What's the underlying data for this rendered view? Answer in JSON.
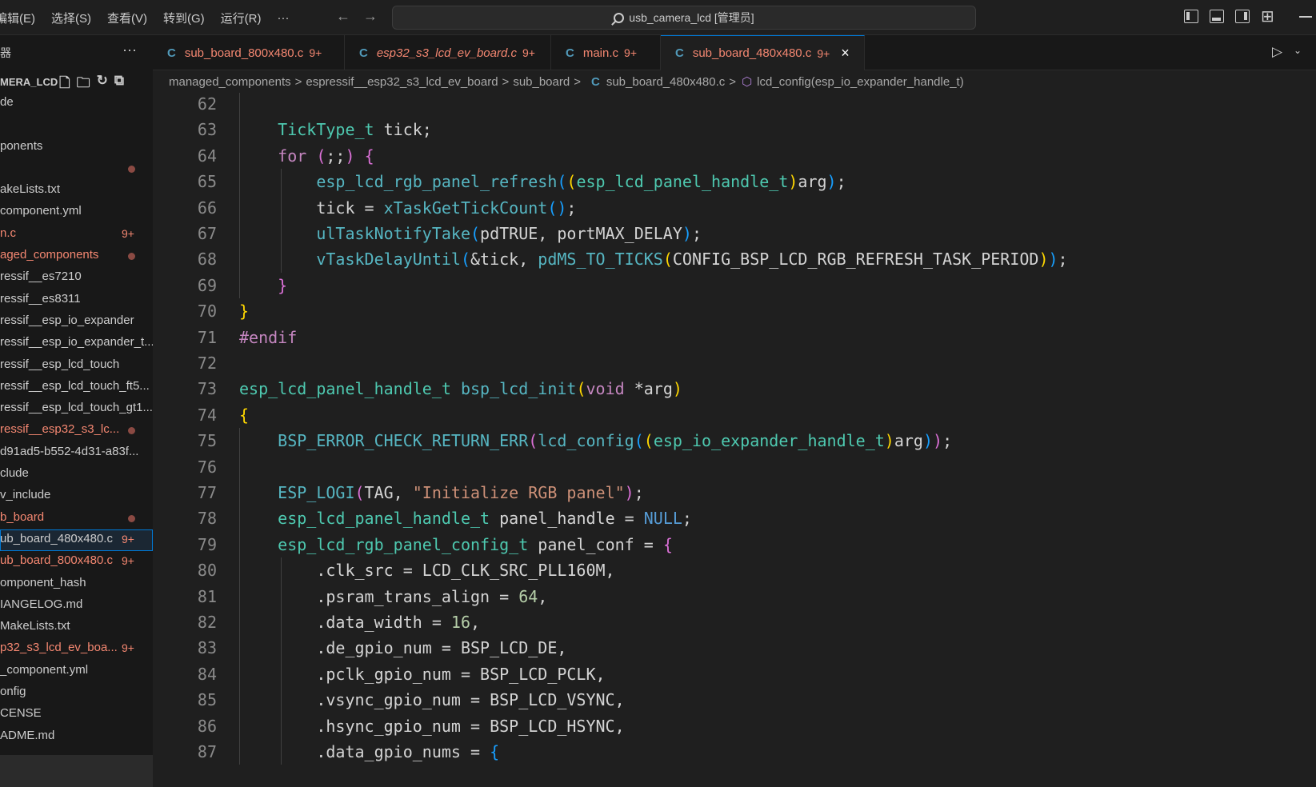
{
  "menu": {
    "items": [
      "编辑(E)",
      "选择(S)",
      "查看(V)",
      "转到(G)",
      "运行(R)"
    ],
    "more": "···"
  },
  "command_center": {
    "text": "usb_camera_lcd [管理员]"
  },
  "sidebar": {
    "header_title": "器",
    "header_more": "···",
    "folder_label": "MERA_LCD",
    "items": [
      {
        "label": "de",
        "color": "normal"
      },
      {
        "label": "",
        "color": "normal"
      },
      {
        "label": "ponents",
        "color": "normal"
      },
      {
        "label": "",
        "color": "normal",
        "dot": true
      },
      {
        "label": "akeLists.txt",
        "color": "normal"
      },
      {
        "label": "component.yml",
        "color": "normal"
      },
      {
        "label": "n.c",
        "color": "red",
        "badge": "9+"
      },
      {
        "label": "aged_components",
        "color": "red",
        "dot": true
      },
      {
        "label": "ressif__es7210",
        "color": "normal"
      },
      {
        "label": "ressif__es8311",
        "color": "normal"
      },
      {
        "label": "ressif__esp_io_expander",
        "color": "normal"
      },
      {
        "label": "ressif__esp_io_expander_t...",
        "color": "normal"
      },
      {
        "label": "ressif__esp_lcd_touch",
        "color": "normal"
      },
      {
        "label": "ressif__esp_lcd_touch_ft5...",
        "color": "normal"
      },
      {
        "label": "ressif__esp_lcd_touch_gt1...",
        "color": "normal"
      },
      {
        "label": "ressif__esp32_s3_lc...",
        "color": "red",
        "dot": true
      },
      {
        "label": "d91ad5-b552-4d31-a83f...",
        "color": "normal"
      },
      {
        "label": "clude",
        "color": "normal"
      },
      {
        "label": "v_include",
        "color": "normal"
      },
      {
        "label": "b_board",
        "color": "red",
        "dot": true
      },
      {
        "label": "ub_board_480x480.c",
        "color": "normal",
        "badge": "9+",
        "selected": true
      },
      {
        "label": "ub_board_800x480.c",
        "color": "red",
        "badge": "9+"
      },
      {
        "label": "omponent_hash",
        "color": "normal"
      },
      {
        "label": "IANGELOG.md",
        "color": "normal"
      },
      {
        "label": "MakeLists.txt",
        "color": "normal"
      },
      {
        "label": "p32_s3_lcd_ev_boa...",
        "color": "red",
        "badge": "9+"
      },
      {
        "label": "_component.yml",
        "color": "normal"
      },
      {
        "label": "onfig",
        "color": "normal"
      },
      {
        "label": "CENSE",
        "color": "normal"
      },
      {
        "label": "ADME.md",
        "color": "normal"
      }
    ]
  },
  "tabs": [
    {
      "icon": "C",
      "name": "sub_board_800x480.c",
      "badge": "9+",
      "italic": false,
      "active": false
    },
    {
      "icon": "C",
      "name": "esp32_s3_lcd_ev_board.c",
      "badge": "9+",
      "italic": true,
      "active": false
    },
    {
      "icon": "C",
      "name": "main.c",
      "badge": "9+",
      "italic": false,
      "active": false
    },
    {
      "icon": "C",
      "name": "sub_board_480x480.c",
      "badge": "9+",
      "italic": false,
      "active": true,
      "close": "×"
    }
  ],
  "breadcrumb": {
    "parts": [
      "managed_components",
      "espressif__esp32_s3_lcd_ev_board",
      "sub_board"
    ],
    "file_icon": "C",
    "file": "sub_board_480x480.c",
    "symbol": "lcd_config(esp_io_expander_handle_t)",
    "sep": ">"
  },
  "editor": {
    "line_numbers": [
      "62",
      "63",
      "64",
      "65",
      "66",
      "67",
      "68",
      "69",
      "70",
      "71",
      "72",
      "73",
      "74",
      "75",
      "76",
      "77",
      "78",
      "79",
      "80",
      "81",
      "82",
      "83",
      "84",
      "85",
      "86",
      "87"
    ],
    "lines": [
      [],
      [
        {
          "t": "    "
        },
        {
          "t": "TickType_t",
          "c": "t-type"
        },
        {
          "t": " tick;",
          "c": "t-var"
        }
      ],
      [
        {
          "t": "    "
        },
        {
          "t": "for",
          "c": "t-kw"
        },
        {
          "t": " "
        },
        {
          "t": "(",
          "c": "t-p2"
        },
        {
          "t": ";;",
          "c": "t-var"
        },
        {
          "t": ")",
          "c": "t-p2"
        },
        {
          "t": " "
        },
        {
          "t": "{",
          "c": "t-p2"
        }
      ],
      [
        {
          "t": "        "
        },
        {
          "t": "esp_lcd_rgb_panel_refresh",
          "c": "t-fnc"
        },
        {
          "t": "(",
          "c": "t-p3"
        },
        {
          "t": "(",
          "c": "t-p1"
        },
        {
          "t": "esp_lcd_panel_handle_t",
          "c": "t-type"
        },
        {
          "t": ")",
          "c": "t-p1"
        },
        {
          "t": "arg",
          "c": "t-var"
        },
        {
          "t": ")",
          "c": "t-p3"
        },
        {
          "t": ";",
          "c": "t-var"
        }
      ],
      [
        {
          "t": "        "
        },
        {
          "t": "tick = ",
          "c": "t-var"
        },
        {
          "t": "xTaskGetTickCount",
          "c": "t-fnc"
        },
        {
          "t": "()",
          "c": "t-p3"
        },
        {
          "t": ";",
          "c": "t-var"
        }
      ],
      [
        {
          "t": "        "
        },
        {
          "t": "ulTaskNotifyTake",
          "c": "t-fnc"
        },
        {
          "t": "(",
          "c": "t-p3"
        },
        {
          "t": "pdTRUE, portMAX_DELAY",
          "c": "t-var"
        },
        {
          "t": ")",
          "c": "t-p3"
        },
        {
          "t": ";",
          "c": "t-var"
        }
      ],
      [
        {
          "t": "        "
        },
        {
          "t": "vTaskDelayUntil",
          "c": "t-fnc"
        },
        {
          "t": "(",
          "c": "t-p3"
        },
        {
          "t": "&tick, ",
          "c": "t-var"
        },
        {
          "t": "pdMS_TO_TICKS",
          "c": "t-fnc"
        },
        {
          "t": "(",
          "c": "t-p1"
        },
        {
          "t": "CONFIG_BSP_LCD_RGB_REFRESH_TASK_PERIOD",
          "c": "t-var"
        },
        {
          "t": ")",
          "c": "t-p1"
        },
        {
          "t": ")",
          "c": "t-p3"
        },
        {
          "t": ";",
          "c": "t-var"
        }
      ],
      [
        {
          "t": "    "
        },
        {
          "t": "}",
          "c": "t-p2"
        }
      ],
      [
        {
          "t": "}",
          "c": "t-p1"
        }
      ],
      [
        {
          "t": "#endif",
          "c": "t-pre"
        }
      ],
      [],
      [
        {
          "t": "esp_lcd_panel_handle_t",
          "c": "t-type"
        },
        {
          "t": " "
        },
        {
          "t": "bsp_lcd_init",
          "c": "t-fnc"
        },
        {
          "t": "(",
          "c": "t-p1"
        },
        {
          "t": "void",
          "c": "t-kw"
        },
        {
          "t": " *arg",
          "c": "t-var"
        },
        {
          "t": ")",
          "c": "t-p1"
        }
      ],
      [
        {
          "t": "{",
          "c": "t-p1"
        }
      ],
      [
        {
          "t": "    "
        },
        {
          "t": "BSP_ERROR_CHECK_RETURN_ERR",
          "c": "t-fnc"
        },
        {
          "t": "(",
          "c": "t-p2"
        },
        {
          "t": "lcd_config",
          "c": "t-fnc"
        },
        {
          "t": "(",
          "c": "t-p3"
        },
        {
          "t": "(",
          "c": "t-p1"
        },
        {
          "t": "esp_io_expander_handle_t",
          "c": "t-type"
        },
        {
          "t": ")",
          "c": "t-p1"
        },
        {
          "t": "arg",
          "c": "t-var"
        },
        {
          "t": ")",
          "c": "t-p3"
        },
        {
          "t": ")",
          "c": "t-p2"
        },
        {
          "t": ";",
          "c": "t-var"
        }
      ],
      [],
      [
        {
          "t": "    "
        },
        {
          "t": "ESP_LOGI",
          "c": "t-fnc"
        },
        {
          "t": "(",
          "c": "t-p2"
        },
        {
          "t": "TAG, ",
          "c": "t-var"
        },
        {
          "t": "\"Initialize RGB panel\"",
          "c": "t-str"
        },
        {
          "t": ")",
          "c": "t-p2"
        },
        {
          "t": ";",
          "c": "t-var"
        }
      ],
      [
        {
          "t": "    "
        },
        {
          "t": "esp_lcd_panel_handle_t",
          "c": "t-type"
        },
        {
          "t": " panel_handle = ",
          "c": "t-var"
        },
        {
          "t": "NULL",
          "c": "t-null"
        },
        {
          "t": ";",
          "c": "t-var"
        }
      ],
      [
        {
          "t": "    "
        },
        {
          "t": "esp_lcd_rgb_panel_config_t",
          "c": "t-type"
        },
        {
          "t": " panel_conf = ",
          "c": "t-var"
        },
        {
          "t": "{",
          "c": "t-p2"
        }
      ],
      [
        {
          "t": "        "
        },
        {
          "t": ".clk_src = LCD_CLK_SRC_PLL160M,",
          "c": "t-var"
        }
      ],
      [
        {
          "t": "        "
        },
        {
          "t": ".psram_trans_align = ",
          "c": "t-var"
        },
        {
          "t": "64",
          "c": "t-num"
        },
        {
          "t": ",",
          "c": "t-var"
        }
      ],
      [
        {
          "t": "        "
        },
        {
          "t": ".data_width = ",
          "c": "t-var"
        },
        {
          "t": "16",
          "c": "t-num"
        },
        {
          "t": ",",
          "c": "t-var"
        }
      ],
      [
        {
          "t": "        "
        },
        {
          "t": ".de_gpio_num = BSP_LCD_DE,",
          "c": "t-var"
        }
      ],
      [
        {
          "t": "        "
        },
        {
          "t": ".pclk_gpio_num = BSP_LCD_PCLK,",
          "c": "t-var"
        }
      ],
      [
        {
          "t": "        "
        },
        {
          "t": ".vsync_gpio_num = BSP_LCD_VSYNC,",
          "c": "t-var"
        }
      ],
      [
        {
          "t": "        "
        },
        {
          "t": ".hsync_gpio_num = BSP_LCD_HSYNC,",
          "c": "t-var"
        }
      ],
      [
        {
          "t": "        "
        },
        {
          "t": ".data_gpio_nums = ",
          "c": "t-var"
        },
        {
          "t": "{",
          "c": "t-p3"
        }
      ]
    ]
  }
}
